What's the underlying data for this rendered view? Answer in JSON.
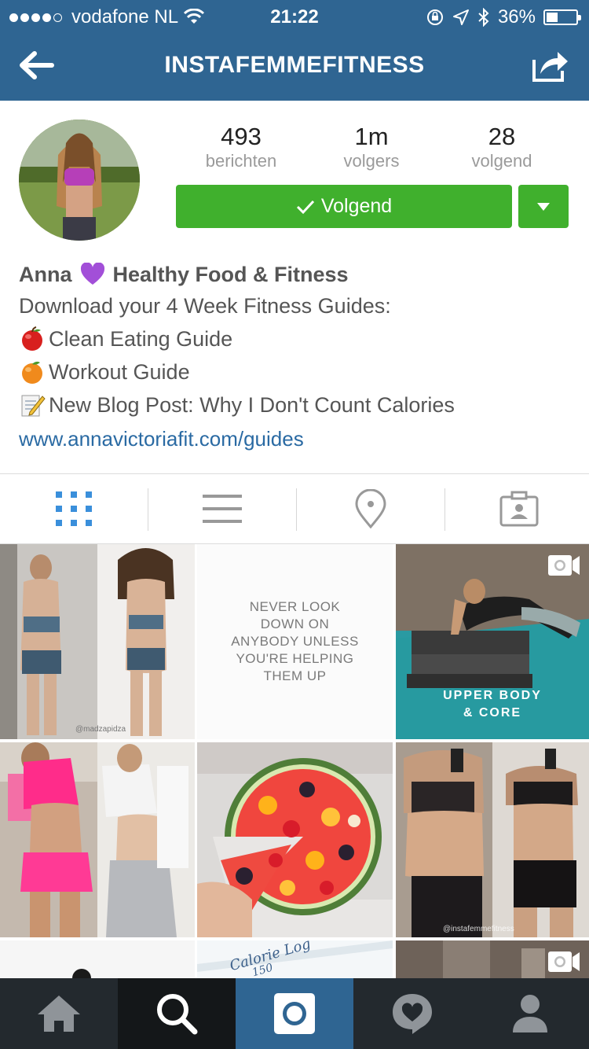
{
  "status_bar": {
    "carrier": "vodafone NL",
    "time": "21:22",
    "battery": "36%",
    "battery_level": 0.36
  },
  "header": {
    "title": "INSTAFEMMEFITNESS",
    "back_icon": "back-arrow-icon",
    "share_icon": "share-icon"
  },
  "profile": {
    "stats": [
      {
        "value": "493",
        "label": "berichten"
      },
      {
        "value": "1m",
        "label": "volgers"
      },
      {
        "value": "28",
        "label": "volgend"
      }
    ],
    "follow_button": "Volgend",
    "bio": {
      "name_first": "Anna",
      "name_rest": "Healthy Food & Fitness",
      "line1": "Download your 4 Week Fitness Guides:",
      "line2": "Clean Eating Guide",
      "line3": "Workout Guide",
      "line4": "New Blog Post: Why I Don't Count Calories",
      "link": "www.annavictoriafit.com/guides"
    }
  },
  "tabs": [
    "grid-icon",
    "list-icon",
    "location-pin-icon",
    "tagged-person-icon"
  ],
  "grid": {
    "quote": [
      "NEVER LOOK",
      "DOWN ON",
      "ANYBODY UNLESS",
      "YOU'RE HELPING",
      "THEM UP"
    ],
    "video_caption": [
      "UPPER BODY",
      "& CORE"
    ],
    "watermark_1": "@madzapidza",
    "watermark_2": "@instafemmefitness",
    "calorie_log": "Calorie Log",
    "calorie_num": "150"
  },
  "bottom_nav": [
    "home-icon",
    "search-icon",
    "camera-icon",
    "activity-icon",
    "profile-icon"
  ],
  "colors": {
    "header": "#2f6592",
    "follow": "#40b02d",
    "link": "#2a6aa3",
    "bottom_bar": "#23292e"
  }
}
